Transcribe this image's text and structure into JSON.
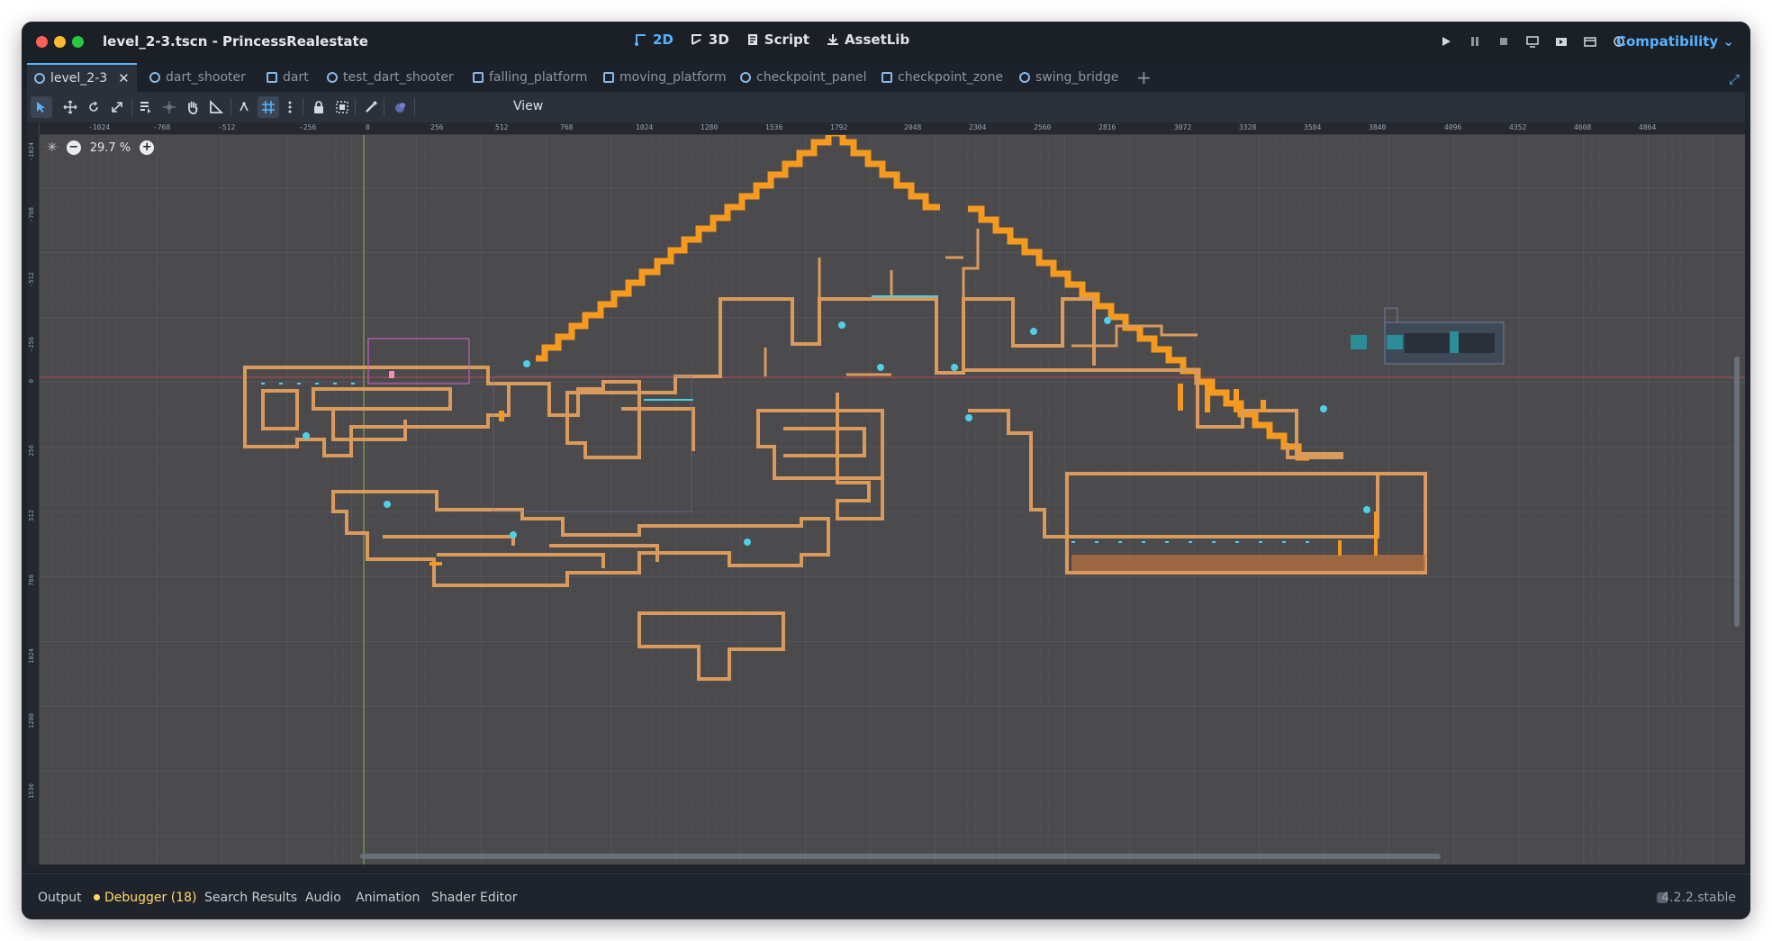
{
  "window": {
    "title": "level_2-3.tscn - PrincessRealestate",
    "modes": [
      {
        "label": "2D",
        "icon": "2d-icon",
        "active": true
      },
      {
        "label": "3D",
        "icon": "3d-icon",
        "active": false
      },
      {
        "label": "Script",
        "icon": "script-icon",
        "active": false
      },
      {
        "label": "AssetLib",
        "icon": "assetlib-icon",
        "active": false
      }
    ],
    "renderer": "Compatibility ⌄"
  },
  "tabs": [
    {
      "label": "level_2-3",
      "icon": "scene-icon",
      "active": true
    },
    {
      "label": "dart_shooter",
      "icon": "scene-icon"
    },
    {
      "label": "dart",
      "icon": "scene-icon"
    },
    {
      "label": "test_dart_shooter",
      "icon": "scene-icon"
    },
    {
      "label": "falling_platform",
      "icon": "scene-icon"
    },
    {
      "label": "moving_platform",
      "icon": "scene-icon"
    },
    {
      "label": "checkpoint_panel",
      "icon": "scene-icon"
    },
    {
      "label": "checkpoint_zone",
      "icon": "scene-icon"
    },
    {
      "label": "swing_bridge",
      "icon": "scene-icon"
    }
  ],
  "toolbar": {
    "view_label": "View"
  },
  "viewport": {
    "zoom": "29.7 %",
    "ruler_top": [
      "-1024",
      "-768",
      "-512",
      "-256",
      "0",
      "256",
      "512",
      "768",
      "1024",
      "1280",
      "1536",
      "1792",
      "2048",
      "2304",
      "2560",
      "2816",
      "3072",
      "3328",
      "3584",
      "3840",
      "4096",
      "4352",
      "4608",
      "4864"
    ],
    "ruler_left": [
      "-1024",
      "-768",
      "-512",
      "-256",
      "0",
      "256",
      "512",
      "768",
      "1024",
      "1280",
      "1536"
    ],
    "colors": {
      "background": "#4a4a4c",
      "tiles": "#d99a5b",
      "stairs": "#f59a1e",
      "markers": "#4fd0e6",
      "x_axis": "#c0474f",
      "y_axis": "#8ab84a"
    }
  },
  "bottom_panel": {
    "tabs": [
      "Output",
      "Debugger (18)",
      "Search Results",
      "Audio",
      "Animation",
      "Shader Editor"
    ],
    "version": "4.2.2.stable"
  }
}
